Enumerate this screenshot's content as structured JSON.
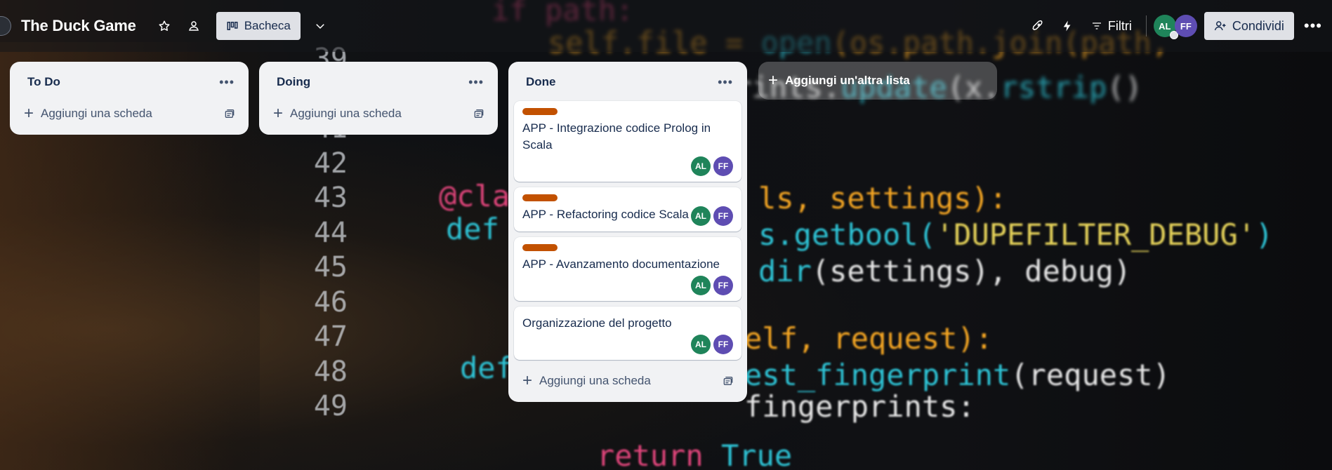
{
  "board": {
    "title": "The Duck Game",
    "view_label": "Bacheca"
  },
  "topbar": {
    "filter_label": "Filtri",
    "share_label": "Condividi",
    "members": [
      {
        "initials": "AL",
        "color": "#1f845a"
      },
      {
        "initials": "FF",
        "color": "#5e4db2"
      }
    ]
  },
  "lists": [
    {
      "title": "To Do",
      "add_card_label": "Aggiungi una scheda",
      "cards": []
    },
    {
      "title": "Doing",
      "add_card_label": "Aggiungi una scheda",
      "cards": []
    },
    {
      "title": "Done",
      "add_card_label": "Aggiungi una scheda",
      "cards": [
        {
          "title": "APP - Integrazione codice Prolog in Scala",
          "label_color": "#c25100",
          "members": [
            "AL",
            "FF"
          ]
        },
        {
          "title": "APP - Refactoring codice Scala",
          "label_color": "#c25100",
          "members": [
            "AL",
            "FF"
          ]
        },
        {
          "title": "APP - Avanzamento documentazione",
          "label_color": "#c25100",
          "members": [
            "AL",
            "FF"
          ]
        },
        {
          "title": "Organizzazione del progetto",
          "label_color": null,
          "members": [
            "AL",
            "FF"
          ]
        }
      ]
    }
  ],
  "add_list_label": "Aggiungi un'altra lista",
  "colors": {
    "avatar_al": "#1f845a",
    "avatar_ff": "#5e4db2",
    "label_orange": "#c25100"
  }
}
